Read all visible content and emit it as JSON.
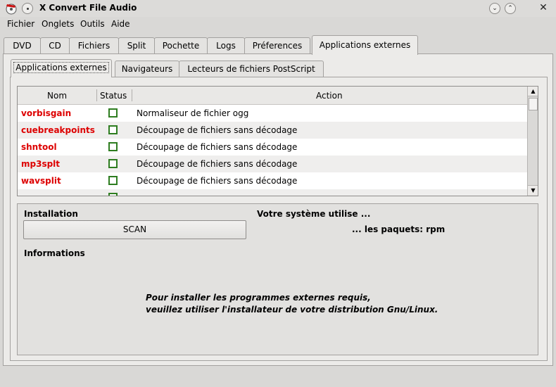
{
  "window": {
    "title": "X Convert File Audio",
    "min_glyph": "⌄",
    "max_glyph": "⌃",
    "close_glyph": "✕"
  },
  "menu": [
    "Fichier",
    "Onglets",
    "Outils",
    "Aide"
  ],
  "outer_tabs": [
    "DVD",
    "CD",
    "Fichiers",
    "Split",
    "Pochette",
    "Logs",
    "Préferences",
    "Applications externes"
  ],
  "outer_active": "Applications externes",
  "inner_tabs": [
    "Applications externes",
    "Navigateurs",
    "Lecteurs de fichiers PostScript"
  ],
  "inner_active": "Applications externes",
  "list": {
    "columns": [
      "Nom",
      "Status",
      "Action"
    ],
    "rows": [
      {
        "name": "vorbisgain",
        "action": "Normaliseur de fichier ogg"
      },
      {
        "name": "cuebreakpoints",
        "action": "Découpage de fichiers sans décodage"
      },
      {
        "name": "shntool",
        "action": "Découpage de fichiers sans décodage"
      },
      {
        "name": "mp3splt",
        "action": "Découpage de fichiers sans décodage"
      },
      {
        "name": "wavsplit",
        "action": "Découpage de fichiers sans décodage"
      }
    ],
    "scroll_up_glyph": "▲",
    "scroll_down_glyph": "▼"
  },
  "installation": {
    "label": "Installation",
    "scan_label": "SCAN",
    "system_label": "Votre système utilise ...",
    "packages_label": "... les paquets: rpm"
  },
  "informations": {
    "label": "Informations",
    "line1": "Pour installer les programmes externes requis,",
    "line2": "veuillez utiliser l'installateur de votre distribution Gnu/Linux."
  },
  "colors": {
    "name_red": "#dd0000",
    "check_green": "#2e7d20"
  }
}
